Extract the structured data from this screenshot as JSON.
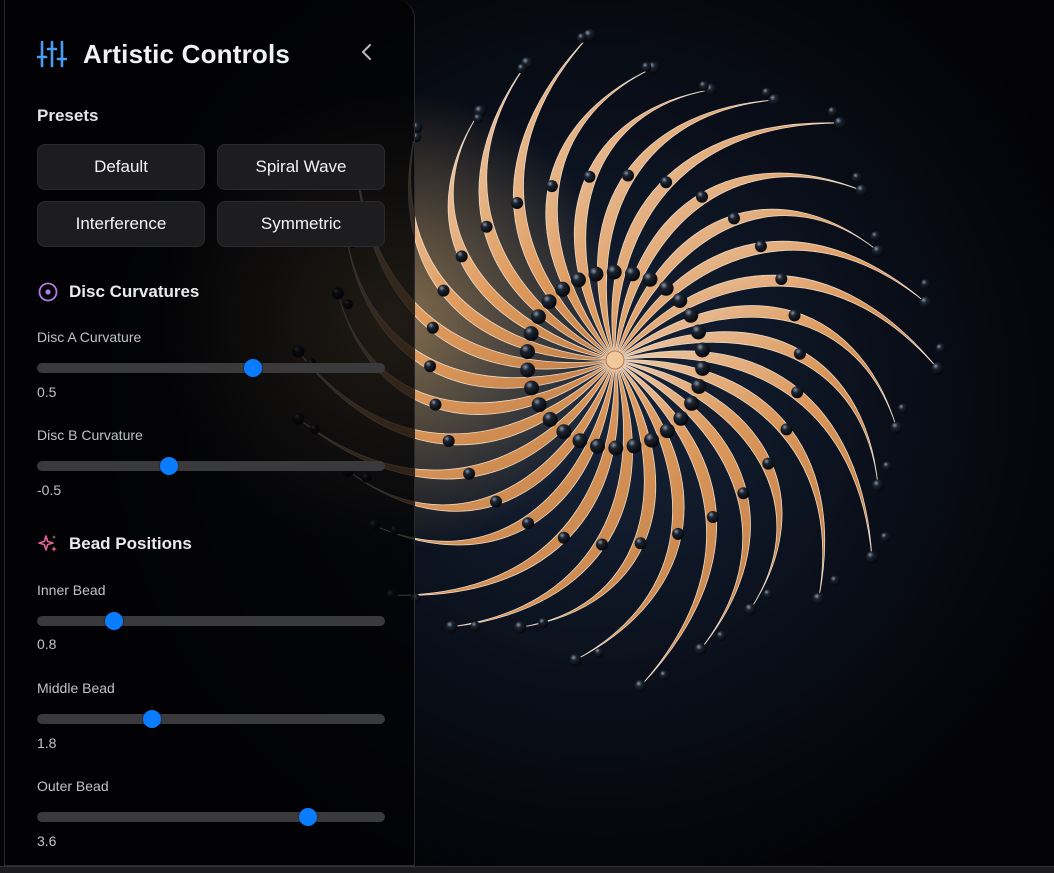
{
  "panel": {
    "title": "Artistic Controls",
    "presets_label": "Presets",
    "presets": [
      "Default",
      "Spiral Wave",
      "Interference",
      "Symmetric"
    ],
    "disc_section": "Disc Curvatures",
    "bead_section": "Bead Positions",
    "sliders": [
      {
        "label": "Disc A Curvature",
        "value": "0.5",
        "fraction": 0.62
      },
      {
        "label": "Disc B Curvature",
        "value": "-0.5",
        "fraction": 0.38
      },
      {
        "label": "Inner Bead",
        "value": "0.8",
        "fraction": 0.22
      },
      {
        "label": "Middle Bead",
        "value": "1.8",
        "fraction": 0.33
      },
      {
        "label": "Outer Bead",
        "value": "3.6",
        "fraction": 0.78
      }
    ]
  },
  "colors": {
    "accent": "#0a7cff",
    "petal": "#e8a668",
    "bead": "#0d1118",
    "disc_icon": "#b678e8",
    "bead_icon": "#e0669a",
    "header_icon": "#4a9bf2"
  },
  "icons": {
    "header": "sliders-icon",
    "collapse": "chevron-left-icon",
    "disc": "target-icon",
    "bead": "sparkles-icon"
  }
}
